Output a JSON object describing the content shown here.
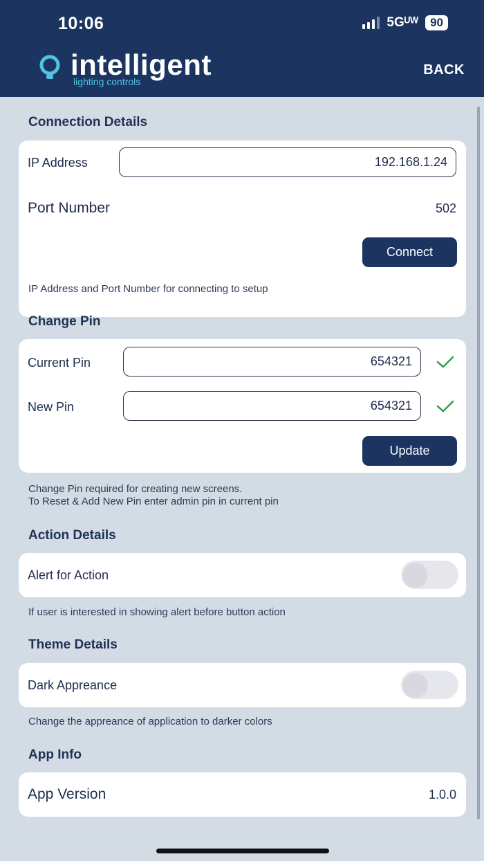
{
  "status_bar": {
    "time": "10:06",
    "network": "5Gᵁᵂ",
    "battery": "90"
  },
  "header": {
    "logo_word": "intelligent",
    "logo_sub": "lighting controls",
    "back_label": "BACK"
  },
  "connection": {
    "title": "Connection Details",
    "ip_label": "IP Address",
    "ip_value": "192.168.1.24",
    "port_label": "Port Number",
    "port_value": "502",
    "connect_label": "Connect",
    "note": "IP Address and Port Number for connecting to setup"
  },
  "pin": {
    "title": "Change Pin",
    "current_label": "Current Pin",
    "current_value": "654321",
    "new_label": "New Pin",
    "new_value": "654321",
    "update_label": "Update",
    "note_line1": "Change Pin required for creating new screens.",
    "note_line2": "To Reset & Add New Pin enter admin pin in current pin"
  },
  "action": {
    "title": "Action Details",
    "alert_label": "Alert for Action",
    "alert_enabled": false,
    "note": "If user is interested in showing alert before button action"
  },
  "theme": {
    "title": "Theme Details",
    "dark_label": "Dark Appreance",
    "dark_enabled": false,
    "note": "Change the appreance of application to darker colors"
  },
  "app_info": {
    "title": "App Info",
    "version_label": "App Version",
    "version_value": "1.0.0"
  },
  "colors": {
    "header_bg": "#1c3460",
    "page_bg": "#d3dbe5",
    "accent": "#4fc3e0",
    "check": "#2e9e4f"
  },
  "icons": [
    "bulb-logo-icon",
    "signal-icon",
    "battery-icon",
    "checkmark-icon"
  ]
}
